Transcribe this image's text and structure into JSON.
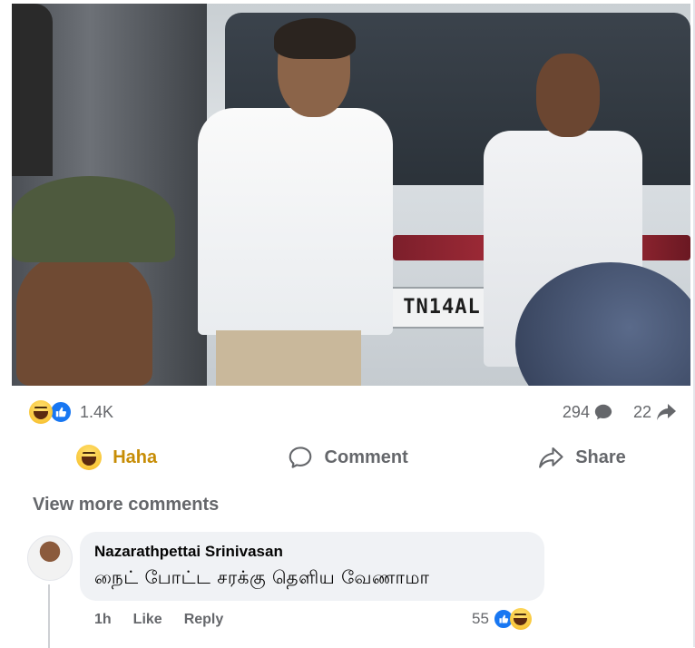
{
  "post": {
    "image_alt": "Video frame of a man in a white shirt standing beside a car",
    "plate_text": "TN14AL",
    "reaction_count": "1.4K",
    "comments_count": "294",
    "shares_count": "22"
  },
  "actions": {
    "haha_label": "Haha",
    "comment_label": "Comment",
    "share_label": "Share"
  },
  "comments_section": {
    "view_more_label": "View more comments",
    "comment": {
      "author": "Nazarathpettai Srinivasan",
      "text": "நைட் போட்ட சரக்கு தெளிய வேணாமா",
      "time": "1h",
      "like_label": "Like",
      "reply_label": "Reply",
      "reaction_count": "55"
    }
  },
  "icons": {
    "reaction_primary": "haha-emoji-icon",
    "reaction_secondary": "like-icon",
    "comments_icon": "comment-bubble-icon",
    "share_icon": "share-arrow-icon"
  },
  "colors": {
    "accent_blue": "#1877f2",
    "haha_gold": "#c78d06",
    "secondary_text": "#65676b",
    "bubble_bg": "#f0f2f5"
  }
}
